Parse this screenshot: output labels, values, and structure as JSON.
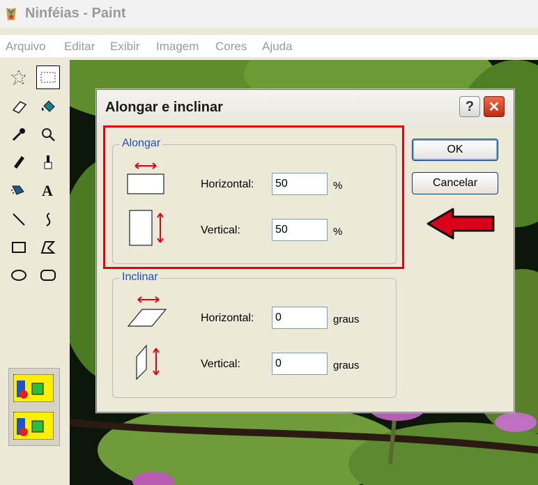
{
  "window": {
    "title": "Ninféias - Paint"
  },
  "menu": [
    "Arquivo",
    "Editar",
    "Exibir",
    "Imagem",
    "Cores",
    "Ajuda"
  ],
  "dialog": {
    "title": "Alongar e inclinar",
    "help": "?",
    "close": "✕",
    "stretch": {
      "label": "Alongar",
      "horizontal_label": "Horizontal:",
      "horizontal_value": "50",
      "horizontal_unit": "%",
      "vertical_label": "Vertical:",
      "vertical_value": "50",
      "vertical_unit": "%"
    },
    "skew": {
      "label": "Inclinar",
      "horizontal_label": "Horizontal:",
      "horizontal_value": "0",
      "horizontal_unit": "graus",
      "vertical_label": "Vertical:",
      "vertical_value": "0",
      "vertical_unit": "graus"
    },
    "ok_label": "OK",
    "cancel_label": "Cancelar"
  },
  "colors": {
    "highlight": "#e3000f",
    "arrow": "#d9001a",
    "group_label": "#1f4ec8"
  }
}
